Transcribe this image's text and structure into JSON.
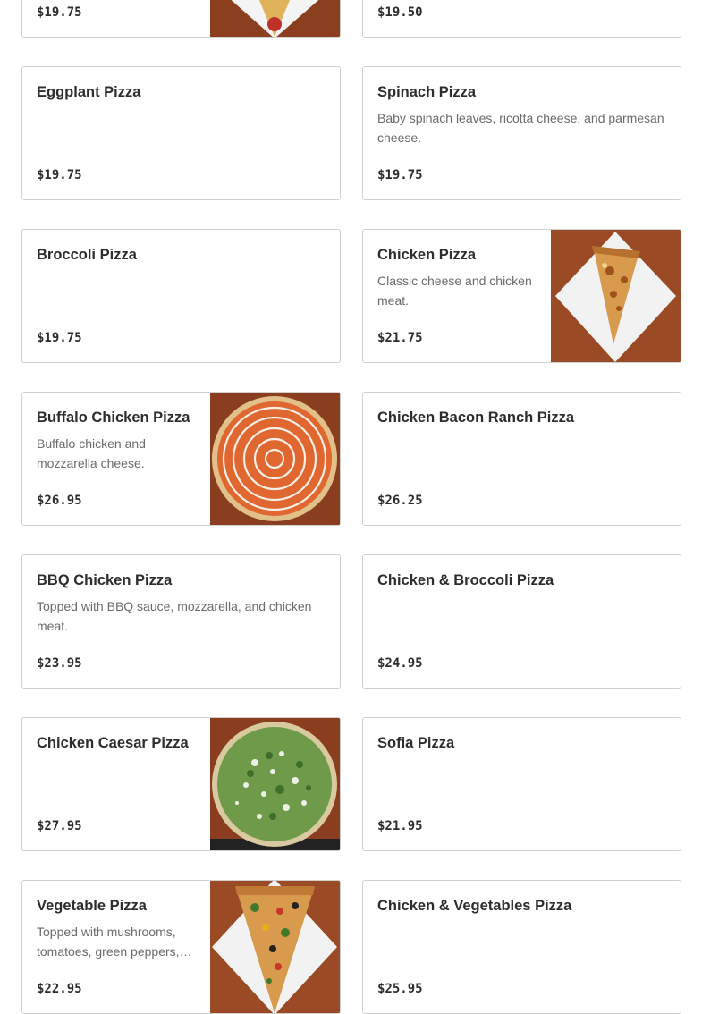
{
  "menu": {
    "items": [
      {
        "name": "",
        "description": "",
        "price": "$19.75",
        "image": "pepperoni-slice-photo"
      },
      {
        "name": "",
        "description": "",
        "price": "$19.50",
        "image": ""
      },
      {
        "name": "Eggplant Pizza",
        "description": "",
        "price": "$19.75",
        "image": ""
      },
      {
        "name": "Spinach Pizza",
        "description": "Baby spinach leaves, ricotta cheese, and parmesan cheese.",
        "price": "$19.75",
        "image": ""
      },
      {
        "name": "Broccoli Pizza",
        "description": "",
        "price": "$19.75",
        "image": ""
      },
      {
        "name": "Chicken Pizza",
        "description": "Classic cheese and chicken meat.",
        "price": "$21.75",
        "image": "chicken-slice-photo"
      },
      {
        "name": "Buffalo Chicken Pizza",
        "description": "Buffalo chicken and mozzarella cheese.",
        "price": "$26.95",
        "image": "buffalo-pie-photo"
      },
      {
        "name": "Chicken Bacon Ranch Pizza",
        "description": "",
        "price": "$26.25",
        "image": ""
      },
      {
        "name": "BBQ Chicken Pizza",
        "description": "Topped with BBQ sauce, mozzarella, and chicken meat.",
        "price": "$23.95",
        "image": ""
      },
      {
        "name": "Chicken & Broccoli Pizza",
        "description": "",
        "price": "$24.95",
        "image": ""
      },
      {
        "name": "Chicken Caesar Pizza",
        "description": "",
        "price": "$27.95",
        "image": "caesar-pie-photo"
      },
      {
        "name": "Sofia Pizza",
        "description": "",
        "price": "$21.95",
        "image": ""
      },
      {
        "name": "Vegetable Pizza",
        "description": "Topped with mushrooms, tomatoes, green peppers, onions, olives.",
        "price": "$22.95",
        "image": "vegetable-slice-photo"
      },
      {
        "name": "Chicken & Vegetables Pizza",
        "description": "",
        "price": "$25.95",
        "image": ""
      }
    ]
  },
  "colors": {
    "card_border": "#d0d0d0",
    "text_primary": "#2d2d2d",
    "text_secondary": "#6b6b6b",
    "photo_background": "#8a3e1f"
  }
}
